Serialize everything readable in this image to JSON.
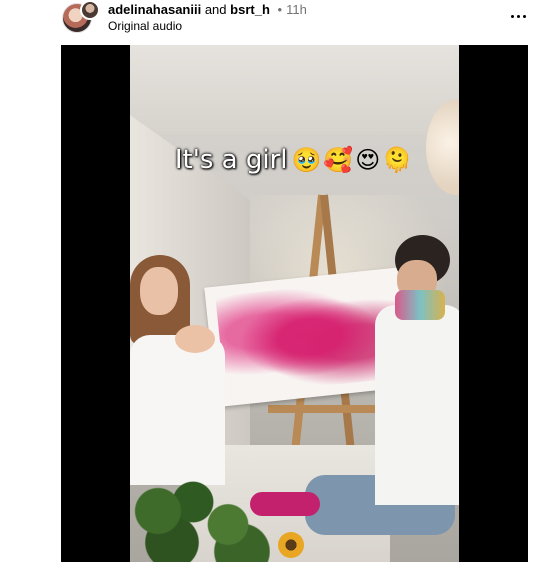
{
  "post": {
    "author_primary": "adelinahasaniii",
    "conjunction": "and",
    "author_secondary": "bsrt_h",
    "separator": "•",
    "time_ago": "11h",
    "audio": "Original audio",
    "more_icon": "ellipsis-icon"
  },
  "video": {
    "caption_text": "It's a girl",
    "caption_emoji": "🥹🥰😍🫠"
  },
  "colors": {
    "paint_pink": "#d6206f",
    "frame_background": "#000000"
  }
}
